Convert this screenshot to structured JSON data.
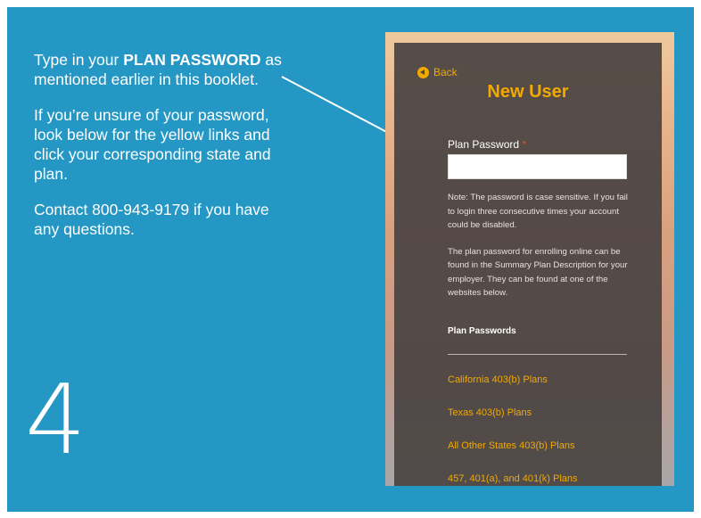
{
  "instructions": {
    "p1_pre": "Type in your ",
    "p1_bold": "PLAN PASSWORD",
    "p1_post": " as mentioned earlier in this booklet.",
    "p2": "If you’re unsure of your password, look below for the yellow links and click your corresponding state and plan.",
    "p3": "Contact 800-943-9179 if you have any questions."
  },
  "step_number": "4",
  "app": {
    "back_label": "Back",
    "title": "New User",
    "password_label": "Plan Password",
    "required_marker": "*",
    "password_value": "",
    "note": "Note: The password is case sensitive. If you fail to login three consecutive times your account could be disabled.",
    "info": "The plan password for enrolling online can be found in the Summary Plan Description for your employer. They can be found at one of the websites below.",
    "section_title": "Plan Passwords",
    "links": [
      "California 403(b) Plans",
      "Texas 403(b) Plans",
      "All Other States 403(b) Plans",
      "457, 401(a), and 401(k) Plans"
    ]
  },
  "colors": {
    "background": "#2497c4",
    "accent": "#f2a900",
    "card": "#4a4442"
  }
}
